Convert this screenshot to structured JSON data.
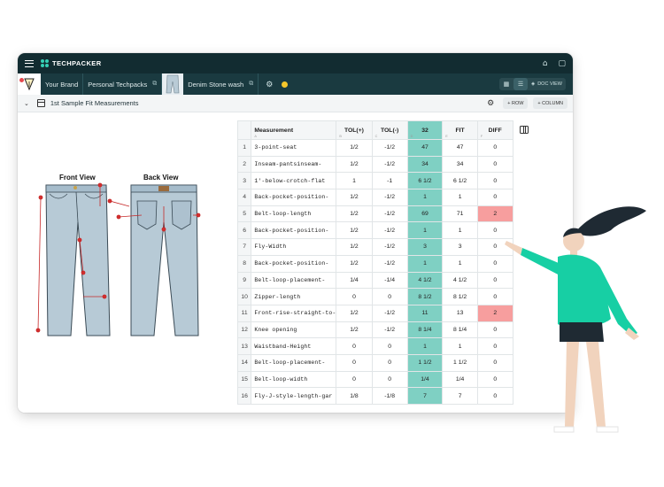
{
  "app": {
    "brand": "TECHPACKER"
  },
  "breadcrumbs": {
    "brand": "Your Brand",
    "techpacks": "Personal Techpacks",
    "product": "Denim Stone wash"
  },
  "view_switch": {
    "doc_label": "DOC VIEW"
  },
  "sheet": {
    "title": "1st Sample Fit Measurements",
    "add_row": "+ ROW",
    "add_column": "+ COLUMN"
  },
  "illustration": {
    "front_label": "Front View",
    "back_label": "Back View"
  },
  "table": {
    "headers": [
      {
        "label": "Measurement",
        "letter": "A"
      },
      {
        "label": "TOL(+)",
        "letter": "B"
      },
      {
        "label": "TOL(-)",
        "letter": "C"
      },
      {
        "label": "32",
        "letter": "D"
      },
      {
        "label": "FIT",
        "letter": "E"
      },
      {
        "label": "DIFF",
        "letter": "F"
      }
    ],
    "rows": [
      [
        "1",
        "3-point-seat",
        "1/2",
        "-1/2",
        "47",
        "47",
        "0"
      ],
      [
        "2",
        "Inseam-pantsinseam-",
        "1/2",
        "-1/2",
        "34",
        "34",
        "0"
      ],
      [
        "3",
        "1'-below-crotch-flat",
        "1",
        "-1",
        "6 1/2",
        "6 1/2",
        "0"
      ],
      [
        "4",
        "Back-pocket-position-",
        "1/2",
        "-1/2",
        "1",
        "1",
        "0"
      ],
      [
        "5",
        "Belt-loop-length",
        "1/2",
        "-1/2",
        "69",
        "71",
        "2"
      ],
      [
        "6",
        "Back-pocket-position-",
        "1/2",
        "-1/2",
        "1",
        "1",
        "0"
      ],
      [
        "7",
        "Fly-Width",
        "1/2",
        "-1/2",
        "3",
        "3",
        "0"
      ],
      [
        "8",
        "Back-pocket-position-",
        "1/2",
        "-1/2",
        "1",
        "1",
        "0"
      ],
      [
        "9",
        "Belt-loop-placement-",
        "1/4",
        "-1/4",
        "4 1/2",
        "4 1/2",
        "0"
      ],
      [
        "10",
        "Zipper-length",
        "0",
        "0",
        "8 1/2",
        "8 1/2",
        "0"
      ],
      [
        "11",
        "Front-rise-straight-to-",
        "1/2",
        "-1/2",
        "11",
        "13",
        "2"
      ],
      [
        "12",
        "Knee opening",
        "1/2",
        "-1/2",
        "8 1/4",
        "8 1/4",
        "0"
      ],
      [
        "13",
        "Waistband-Height",
        "0",
        "0",
        "1",
        "1",
        "0"
      ],
      [
        "14",
        "Belt-loop-placement-",
        "0",
        "0",
        "1 1/2",
        "1 1/2",
        "0"
      ],
      [
        "15",
        "Belt-loop-width",
        "0",
        "0",
        "1/4",
        "1/4",
        "0"
      ],
      [
        "16",
        "Fly-J-style-length-gar",
        "1/8",
        "-1/8",
        "7",
        "7",
        "0"
      ]
    ],
    "highlight_rows": [
      4,
      10
    ]
  },
  "colors": {
    "topbar": "#122c31",
    "accent_teal": "#7fd0c3",
    "diff_alert": "#f79e9e",
    "figure_shirt": "#17cfa4"
  }
}
